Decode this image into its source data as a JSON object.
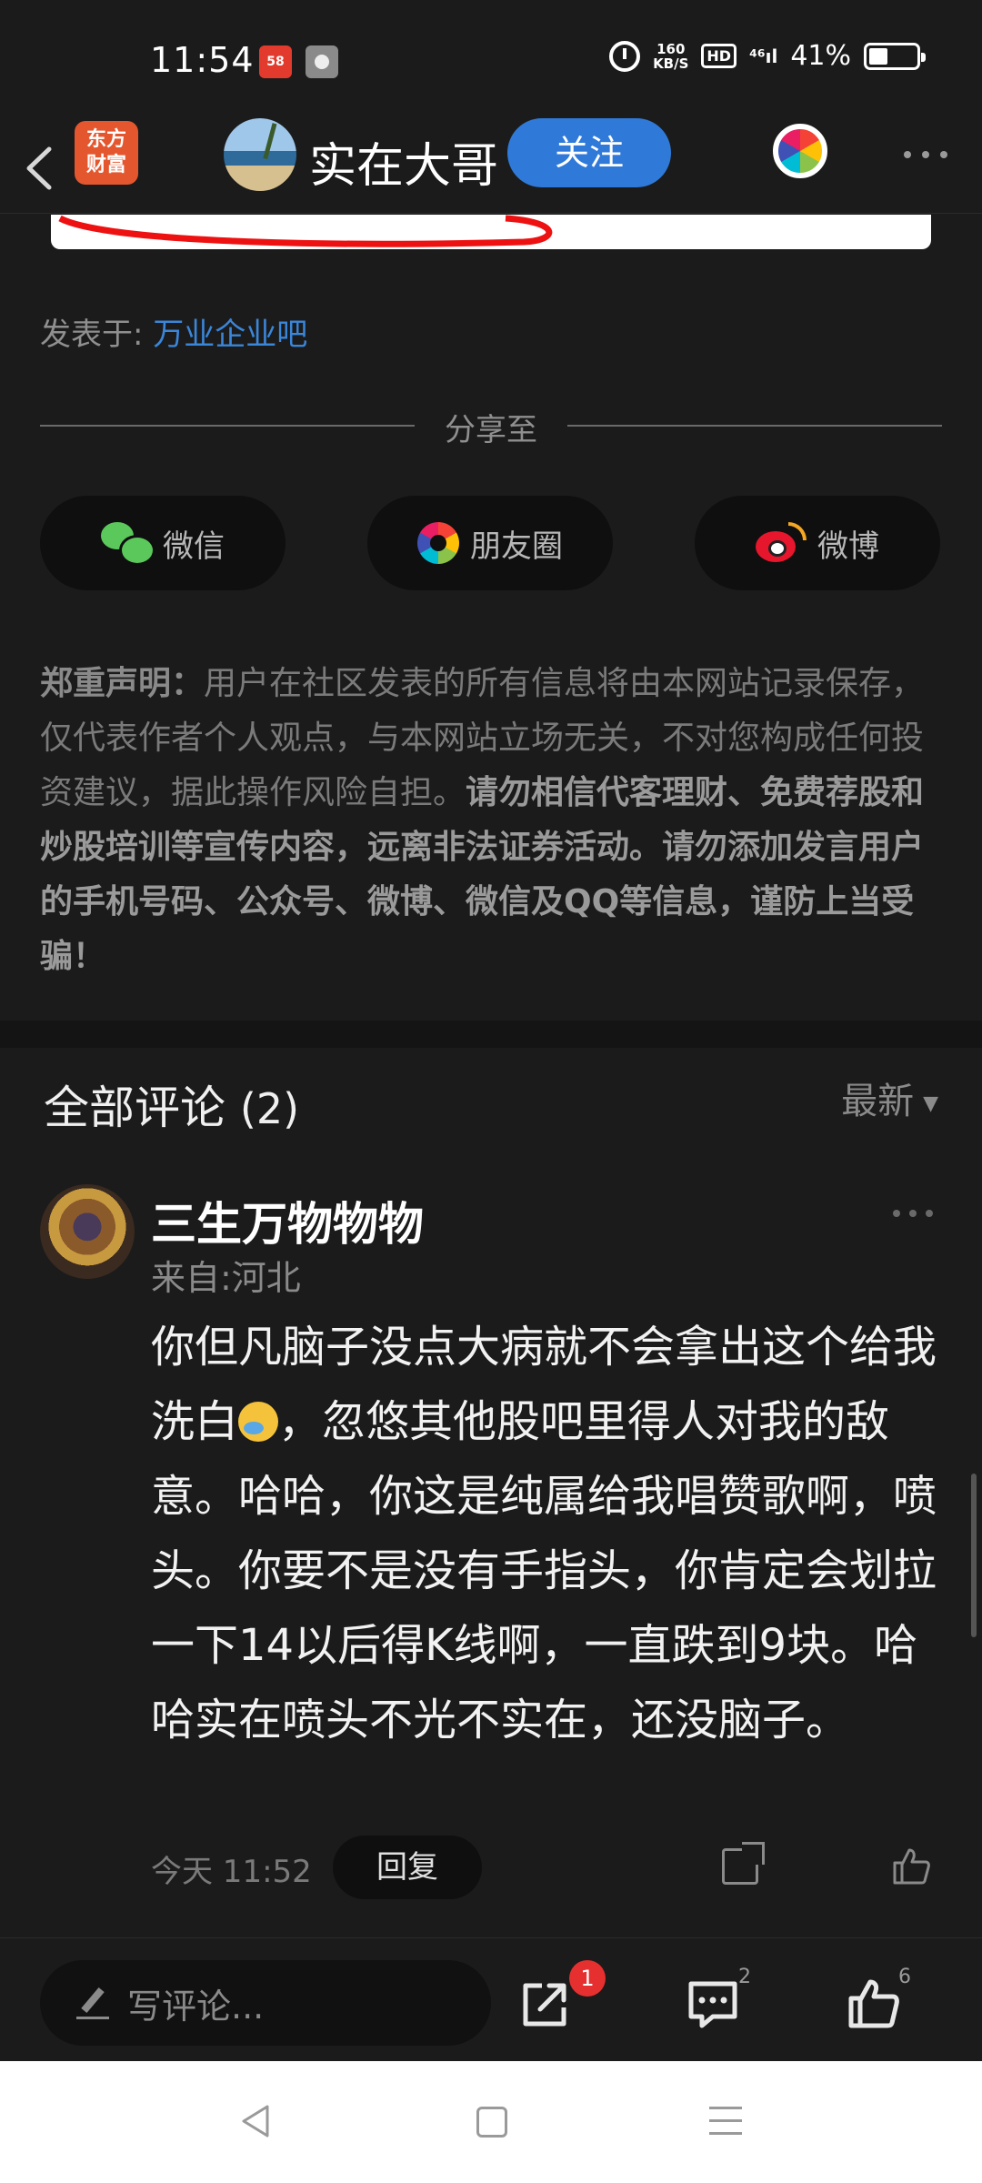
{
  "status_bar": {
    "time": "11:54",
    "app_badge": "58",
    "speed_top": "160",
    "speed_bottom": "KB/S",
    "hd": "HD",
    "signal": "⁴⁶ıl",
    "battery": "41%"
  },
  "header": {
    "brand_logo": "东方\n财富",
    "user_name": "实在大哥",
    "follow_label": "关注"
  },
  "post": {
    "posted_prefix": "发表于: ",
    "bar_name": "万业企业吧"
  },
  "share": {
    "title": "分享至",
    "wechat": "微信",
    "moments": "朋友圈",
    "weibo": "微博"
  },
  "disclaimer": {
    "title": "郑重声明",
    "colon": "：",
    "text_plain": "用户在社区发表的所有信息将由本网站记录保存，仅代表作者个人观点，与本网站立场无关，不对您构成任何投资建议，据此操作风险自担。",
    "text_bold": "请勿相信代客理财、免费荐股和炒股培训等宣传内容，远离非法证券活动。请勿添加发言用户的手机号码、公众号、微博、微信及QQ等信息，谨防上当受骗！"
  },
  "comments": {
    "title": "全部评论",
    "count": "(2)",
    "sort_label": "最新",
    "items": [
      {
        "user": "三生万物物物",
        "location": "来自:河北",
        "text_before_emoji": "你但凡脑子没点大病就不会拿出这个给我洗白",
        "text_after_emoji": "，忽悠其他股吧里得人对我的敌意。哈哈，你这是纯属给我唱赞歌啊，喷头。你要不是没有手指头，你肯定会划拉一下14以后得K线啊，一直跌到9块。哈哈实在喷头不光不实在，还没脑子。",
        "time": "今天 11:52",
        "reply_label": "回复"
      }
    ]
  },
  "bottom_bar": {
    "input_placeholder": "写评论...",
    "share_badge": "1",
    "comment_count": "2",
    "like_count": "6"
  },
  "colors": {
    "background": "#1b1b1b",
    "accent_blue": "#2f7ad9",
    "link_blue": "#3a86d9",
    "badge_red": "#e5302f",
    "brand_orange": "#e4572e"
  }
}
